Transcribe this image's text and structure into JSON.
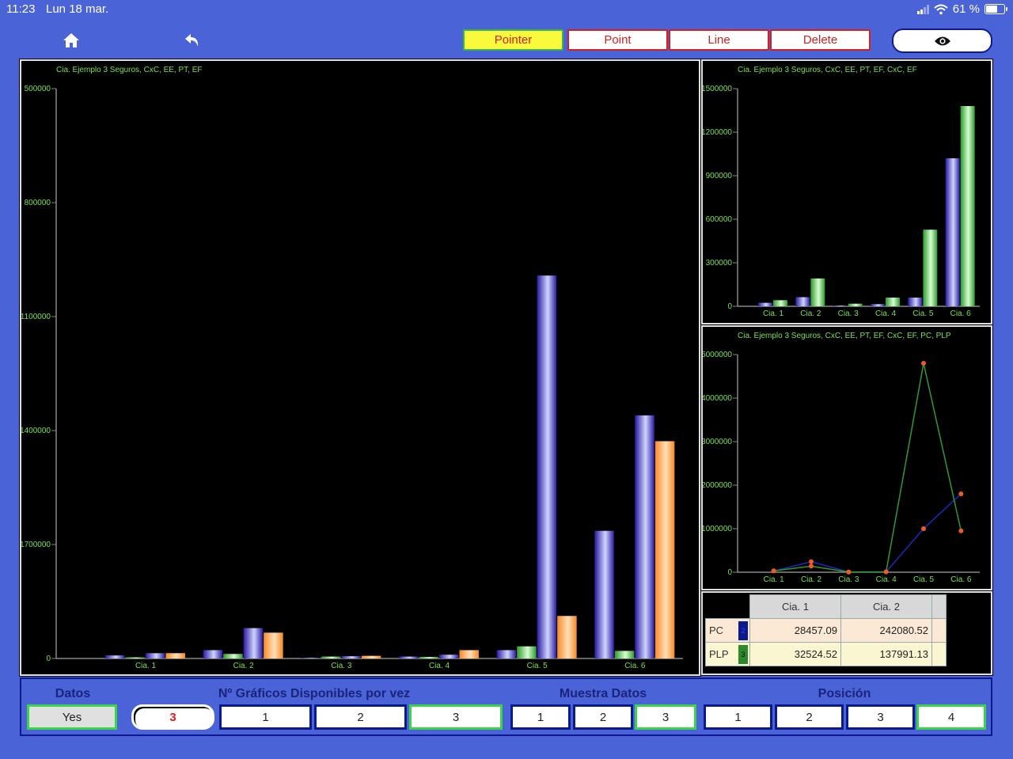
{
  "status_bar": {
    "time": "11:23",
    "date": "Lun 18 mar.",
    "battery": "61 %"
  },
  "toolbar": {
    "pointer": "Pointer",
    "point": "Point",
    "line": "Line",
    "delete": "Delete"
  },
  "colors": {
    "background": "#4a63d6",
    "active_tool": "#fafa3c",
    "tool_border": "#d62020",
    "chart_text": "#7fe04a"
  },
  "chart_data": [
    {
      "type": "bar",
      "title": "Cia. Ejemplo 3 Seguros, CxC, EE, PT, EF",
      "categories": [
        "Cia. 1",
        "Cia. 2",
        "Cia. 3",
        "Cia. 4",
        "Cia. 5",
        "Cia. 6"
      ],
      "series": [
        {
          "values": [
            40000,
            110000,
            8000,
            25000,
            110000,
            1680000
          ]
        },
        {
          "values": [
            15000,
            60000,
            25000,
            20000,
            160000,
            100000
          ]
        },
        {
          "values": [
            70000,
            400000,
            30000,
            50000,
            5040000,
            3200000
          ]
        },
        {
          "values": [
            70000,
            340000,
            35000,
            110000,
            560000,
            2860000
          ]
        }
      ],
      "yticks": [
        "0",
        "1700000",
        "1400000",
        "1100000",
        "800000",
        "500000"
      ],
      "yticks_values": [
        0,
        1500000,
        3000000,
        4500000,
        6000000,
        7500000
      ]
    },
    {
      "type": "bar",
      "title": "Cia. Ejemplo 3 Seguros, CxC, EE, PT, EF, CxC, EF",
      "categories": [
        "Cia. 1",
        "Cia. 2",
        "Cia. 3",
        "Cia. 4",
        "Cia. 5",
        "Cia. 6"
      ],
      "series": [
        {
          "values": [
            40000,
            105000,
            8000,
            25000,
            100000,
            1700000
          ]
        },
        {
          "values": [
            70000,
            320000,
            30000,
            100000,
            880000,
            2300000
          ]
        }
      ],
      "yticks": [
        "0",
        "300000",
        "600000",
        "900000",
        "1200000",
        "1500000"
      ],
      "yticks_values": [
        0,
        500000,
        1000000,
        1500000,
        2000000,
        2500000
      ]
    },
    {
      "type": "line",
      "title": "Cia. Ejemplo 3 Seguros, CxC, EE, PT, EF, CxC, EF, PC, PLP",
      "categories": [
        "Cia. 1",
        "Cia. 2",
        "Cia. 3",
        "Cia. 4",
        "Cia. 5",
        "Cia. 6"
      ],
      "series": [
        {
          "values": [
            28457.09,
            242080.52,
            5000,
            10000,
            1000000,
            1800000
          ]
        },
        {
          "values": [
            32524.52,
            137991.13,
            5000,
            10000,
            4800000,
            950000
          ]
        }
      ],
      "yticks": [
        "0",
        "1000000",
        "2000000",
        "3000000",
        "4000000",
        "5000000"
      ],
      "yticks_values": [
        0,
        1000000,
        2000000,
        3000000,
        4000000,
        5000000
      ],
      "ylim": [
        0,
        5000000
      ]
    }
  ],
  "table": {
    "columns": [
      "Cia. 1",
      "Cia. 2"
    ],
    "rows": [
      {
        "label": "PC",
        "marker": "2",
        "values": [
          "28457.09",
          "242080.52"
        ]
      },
      {
        "label": "PLP",
        "marker": "3",
        "values": [
          "32524.52",
          "137991.13"
        ]
      }
    ]
  },
  "bottom": {
    "datos_label": "Datos",
    "datos_value": "Yes",
    "graficos_label": "Nº Gráficos Disponibles por vez",
    "graficos_current": "3",
    "graficos_options": [
      "1",
      "2",
      "3"
    ],
    "muestra_label": "Muestra Datos",
    "muestra_options": [
      "1",
      "2",
      "3"
    ],
    "posicion_label": "Posición",
    "posicion_options": [
      "1",
      "2",
      "3",
      "4"
    ]
  }
}
